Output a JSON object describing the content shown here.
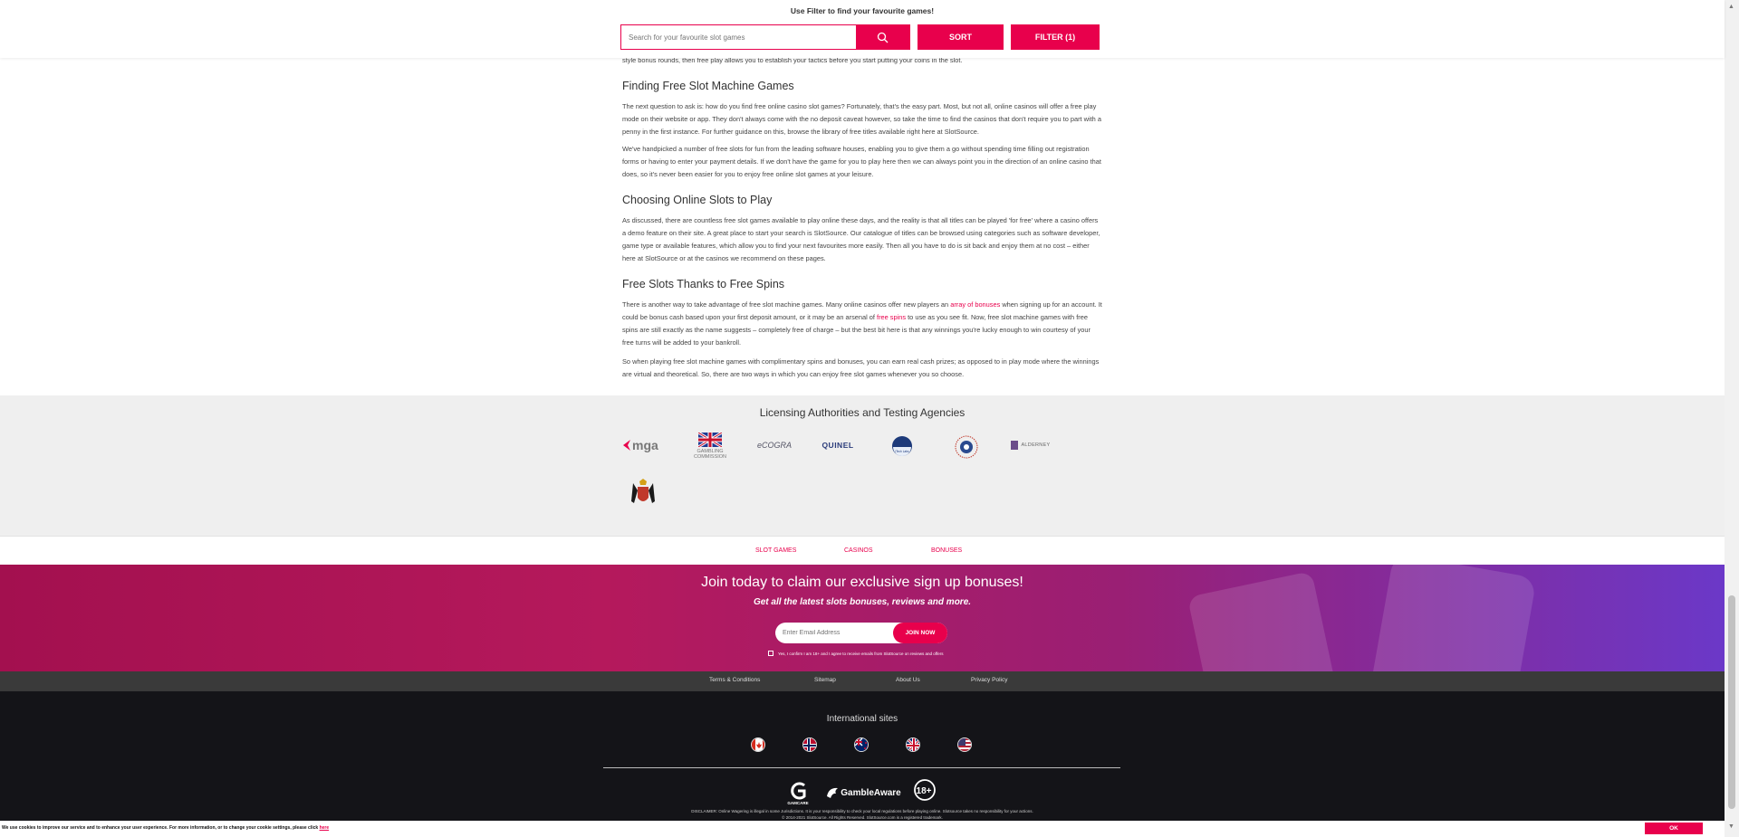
{
  "filter_bar": {
    "hint": "Use Filter to find your favourite games!",
    "search_placeholder": "Search for your favourite slot games",
    "sort_label": "SORT",
    "filter_label": "FILTER (1)"
  },
  "article": {
    "top_fragment": "style bonus rounds, then free play allows you to establish your tactics before you start putting your coins in the slot.",
    "sections": [
      {
        "heading": "Finding Free Slot Machine Games",
        "paragraphs": [
          "The next question to ask is: how do you find free online casino slot games? Fortunately, that's the easy part. Most, but not all, online casinos will offer a free play mode on their website or app. They don't always come with the no deposit caveat however, so take the time to find the casinos that don't require you to part with a penny in the first instance. For further guidance on this, browse the library of free titles available right here at SlotSource.",
          "We've handpicked a number of free slots for fun from the leading software houses, enabling you to give them a go without spending time filling out registration forms or having to enter your payment details. If we don't have the game for you to play here then we can always point you in the direction of an online casino that does, so it's never been easier for you to enjoy free online slot games at your leisure."
        ]
      },
      {
        "heading": "Choosing Online Slots to Play",
        "paragraphs": [
          "As discussed, there are countless free slot games available to play online these days, and the reality is that all titles can be played 'for free' where a casino offers a demo feature on their site. A great place to start your search is SlotSource. Our catalogue of titles can be browsed using categories such as software developer, game type or available features, which allow you to find your next favourites more easily. Then all you have to do is sit back and enjoy them at no cost – either here at SlotSource or at the casinos we recommend on these pages."
        ]
      },
      {
        "heading": "Free Slots Thanks to Free Spins",
        "paragraphs": [
          "So when playing free slot machine games with complimentary spins and bonuses, you can earn real cash prizes; as opposed to in play mode where the winnings are virtual and theoretical. So, there are two ways in which you can enjoy free slot games whenever you so choose."
        ],
        "rich_paragraph": {
          "part1": "There is another way to take advantage of free slot machine games. Many online casinos offer new players an ",
          "link1": "array of bonuses",
          "part2": " when signing up for an account. It could be bonus cash based upon your first deposit amount, or it may be an arsenal of ",
          "link2": "free spins",
          "part3": " to use as you see fit. Now, free slot machine games with free spins are still exactly as the name suggests – completely free of charge – but the best bit here is that any winnings you're lucky enough to win courtesy of your free turns will be added to your bankroll."
        }
      }
    ]
  },
  "licensing": {
    "title": "Licensing Authorities and Testing Agencies",
    "logos": [
      {
        "name": "mga",
        "text": "mga"
      },
      {
        "name": "gambling-commission",
        "text": "GAMBLING COMMISSION"
      },
      {
        "name": "ecogra",
        "text": "eCOGRA"
      },
      {
        "name": "quinel",
        "text": "QUINEL"
      },
      {
        "name": "itech-labs",
        "text": "iTech Labs"
      },
      {
        "name": "gli",
        "text": ""
      },
      {
        "name": "alderney",
        "text": "ALDERNEY"
      },
      {
        "name": "isle-of-man",
        "text": ""
      }
    ]
  },
  "footer_nav": {
    "slot_games": "SLOT GAMES",
    "casinos": "CASINOS",
    "bonuses": "BONUSES"
  },
  "signup": {
    "title": "Join today to claim our exclusive sign up bonuses!",
    "subtitle": "Get all the latest slots bonuses, reviews and more.",
    "email_placeholder": "Enter Email Address",
    "join_label": "JOIN NOW",
    "consent": "Yes, I confirm I am 18+ and I agree to receive emails from SlotSource on reviews and offers"
  },
  "links": {
    "terms": "Terms & Conditions",
    "sitemap": "Sitemap",
    "about": "About Us",
    "privacy": "Privacy Policy"
  },
  "international": {
    "title": "International sites",
    "flags": [
      "canada-flag",
      "norway-flag",
      "new-zealand-flag",
      "united-kingdom-flag",
      "united-states-flag"
    ]
  },
  "badges": {
    "gamcare": "GAMCARE",
    "gambleaware": "GambleAware",
    "age": "18+"
  },
  "disclaimer": {
    "line1": "DISCLAIMER: Online Wagering is illegal in some Jurisdictions. It is your responsibility to check your local regulations before playing online. Slotsource takes no responsibility for your actions.",
    "line2": "© 2014-2021 SlotSource. All Rights Reserved. SlotSource.com is a registered trademark."
  },
  "cookie": {
    "text": "We use cookies to improve our service and to enhance your user experience. For more information, or to change your cookie settings, please click ",
    "link": "here",
    "ok": "OK"
  },
  "colors": {
    "accent": "#e8004c",
    "footer_dark": "#141418",
    "licensing_bg": "#efefef"
  }
}
